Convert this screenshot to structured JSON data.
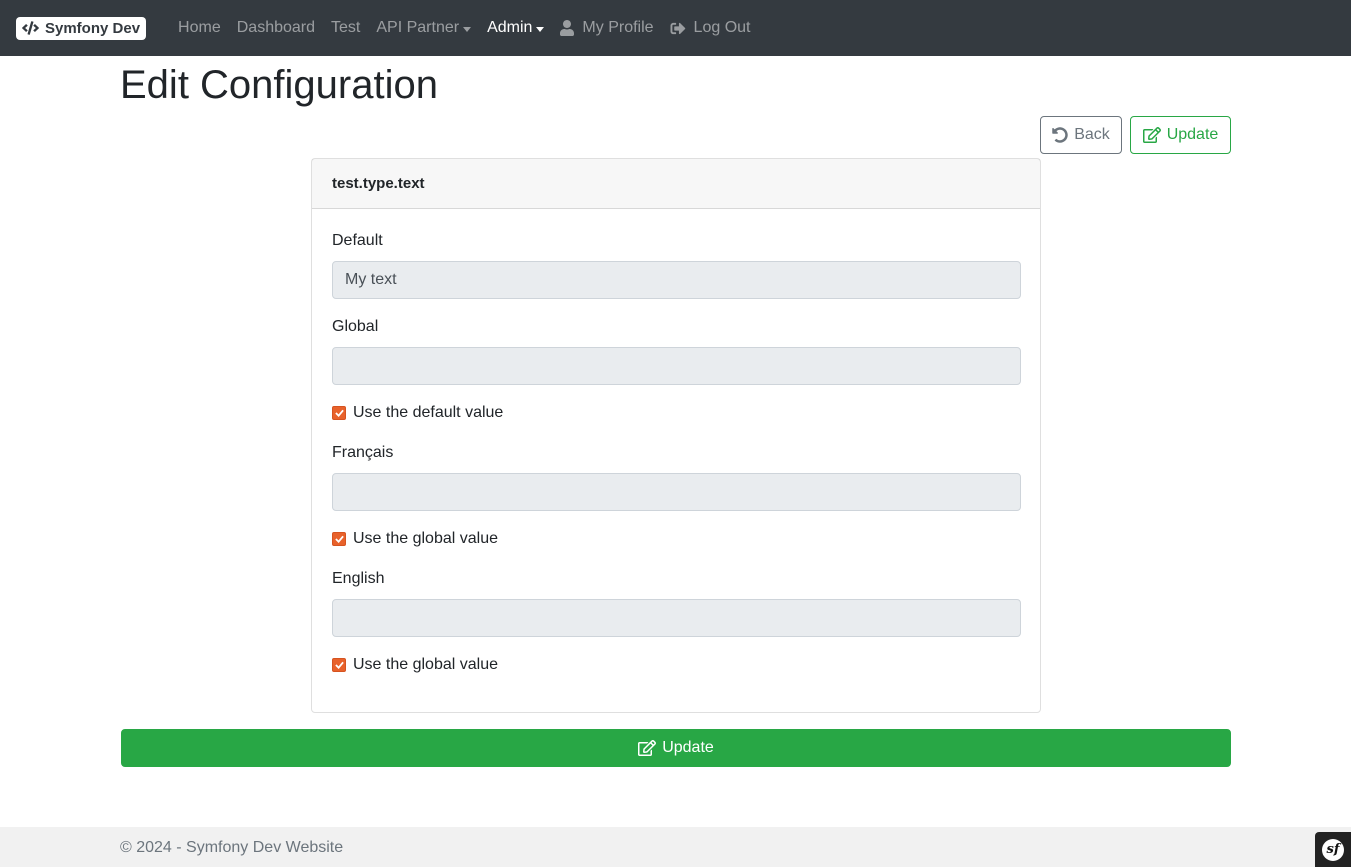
{
  "navbar": {
    "brand_label": "Symfony Dev",
    "items": [
      {
        "label": "Home"
      },
      {
        "label": "Dashboard"
      },
      {
        "label": "Test"
      },
      {
        "label": "API Partner"
      },
      {
        "label": "Admin"
      },
      {
        "label": "My Profile"
      },
      {
        "label": "Log Out"
      }
    ]
  },
  "page": {
    "title": "Edit Configuration",
    "back_label": "Back",
    "update_label": "Update"
  },
  "card": {
    "header": "test.type.text",
    "fields": [
      {
        "label": "Default",
        "value": "My text"
      },
      {
        "label": "Global",
        "value": "",
        "checkbox": "Use the default value",
        "checked": true
      },
      {
        "label": "Français",
        "value": "",
        "checkbox": "Use the global value",
        "checked": true
      },
      {
        "label": "English",
        "value": "",
        "checkbox": "Use the global value",
        "checked": true
      }
    ]
  },
  "footer": {
    "text": "© 2024 - Symfony Dev Website"
  },
  "colors": {
    "navbar_bg": "#343a40",
    "success": "#28a745",
    "secondary": "#6c757d",
    "checkbox": "#e8622b"
  }
}
